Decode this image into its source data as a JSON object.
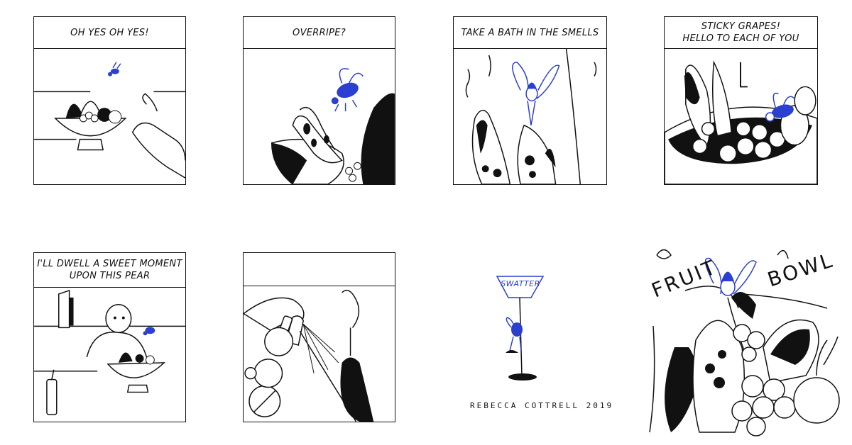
{
  "panels": [
    {
      "caption": "OH YES OH YES!"
    },
    {
      "caption": "OVERRIPE?"
    },
    {
      "caption": "TAKE A BATH IN THE SMELLS"
    },
    {
      "caption": "STICKY GRAPES!\nHELLO TO EACH OF YOU"
    },
    {
      "caption": "I'LL DWELL A SWEET MOMENT\nUPON THIS PEAR"
    },
    {
      "caption": ""
    }
  ],
  "swatter_label": "SWATTER",
  "signature": "REBECCA COTTRELL 2019",
  "cover": {
    "word1": "FRUIT",
    "word2": "BOWL"
  },
  "colors": {
    "ink": "#111111",
    "accent": "#2b3fd0",
    "paper": "#ffffff"
  }
}
